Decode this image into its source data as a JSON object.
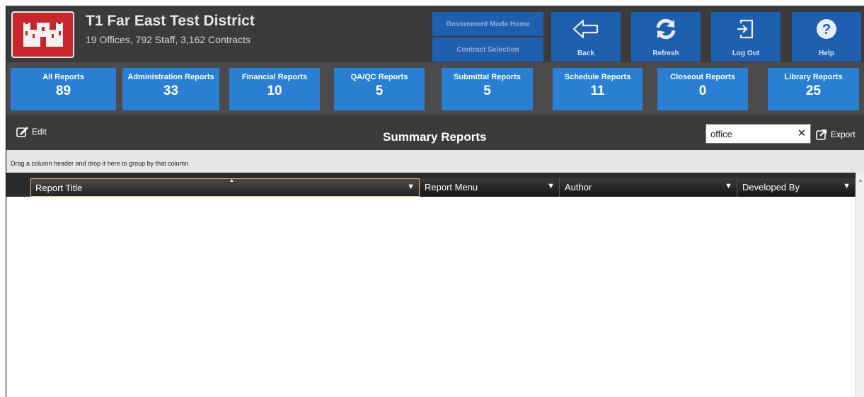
{
  "header": {
    "org_title": "T1 Far East Test District",
    "org_subtitle": "19 Offices, 792 Staff, 3,162 Contracts",
    "gov_mode_label": "Government Mode Home",
    "contract_selection_label": "Contract Selection",
    "nav": {
      "back": "Back",
      "refresh": "Refresh",
      "logout": "Log Out",
      "help": "Help"
    }
  },
  "tiles": [
    {
      "label": "All Reports",
      "count": "89"
    },
    {
      "label": "Administration Reports",
      "count": "33"
    },
    {
      "label": "Financial Reports",
      "count": "10"
    },
    {
      "label": "QA/QC Reports",
      "count": "5"
    },
    {
      "label": "Submittal Reports",
      "count": "5"
    },
    {
      "label": "Schedule Reports",
      "count": "11"
    },
    {
      "label": "Closeout Reports",
      "count": "0"
    },
    {
      "label": "Library Reports",
      "count": "25"
    }
  ],
  "toolbar": {
    "edit_label": "Edit",
    "title": "Summary Reports",
    "search_value": "office",
    "clear_label": "✕",
    "export_label": "Export"
  },
  "grid": {
    "group_hint": "Drag a column header and drop it here to group by that column",
    "columns": [
      "Report Title",
      "Report Menu",
      "Author",
      "Developed By"
    ]
  },
  "colors": {
    "header_bg": "#3b3b3b",
    "button_blue": "#1f5fb0",
    "tile_blue": "#2a7fd3",
    "logo_red": "#c8262c"
  }
}
